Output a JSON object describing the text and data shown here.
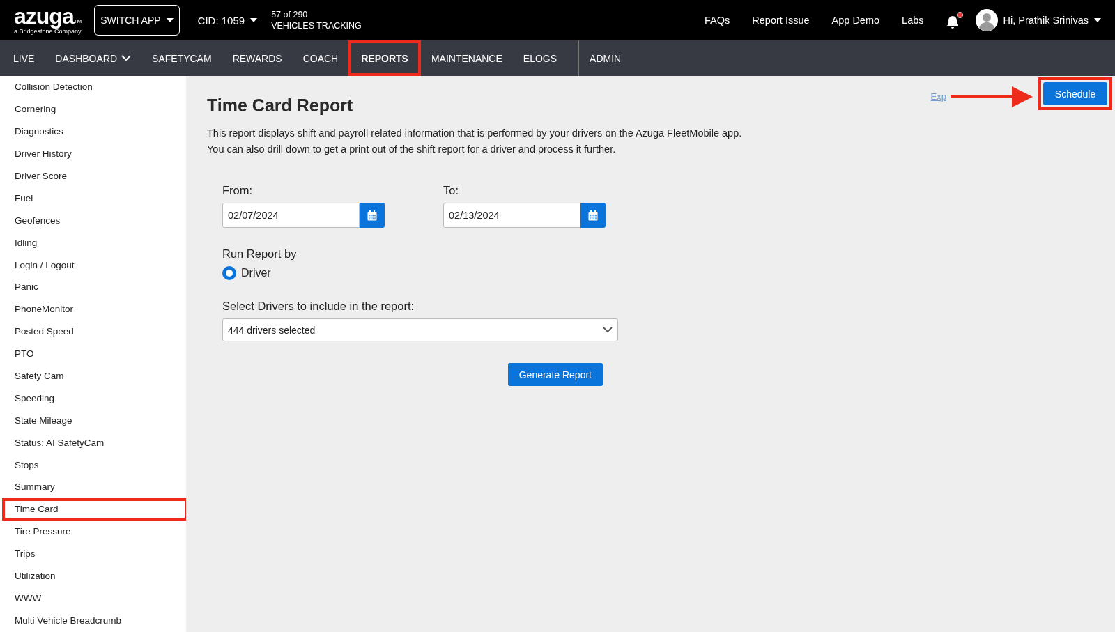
{
  "header": {
    "logo": "azuga",
    "logo_mark": "TM",
    "tagline": "a Bridgestone Company",
    "switch_app": "SWITCH APP",
    "cid": "CID: 1059",
    "tracking": [
      "57 of 290",
      "VEHICLES TRACKING"
    ],
    "links": [
      "FAQs",
      "Report Issue",
      "App Demo",
      "Labs"
    ],
    "notification_alert": true,
    "user": "Hi, Prathik Srinivas"
  },
  "nav": [
    {
      "label": "LIVE",
      "selected": false,
      "highlighted": false
    },
    {
      "label": "DASHBOARD",
      "selected": false,
      "highlighted": false,
      "dropdown": true
    },
    {
      "label": "SAFETYCAM",
      "selected": false,
      "highlighted": false
    },
    {
      "label": "REWARDS",
      "selected": false,
      "highlighted": false
    },
    {
      "label": "COACH",
      "selected": false,
      "highlighted": false
    },
    {
      "label": "REPORTS",
      "selected": true,
      "highlighted": true
    },
    {
      "label": "MAINTENANCE",
      "selected": false,
      "highlighted": false
    },
    {
      "label": "ELOGS",
      "selected": false,
      "highlighted": false
    },
    {
      "label": "ADMIN",
      "selected": false,
      "highlighted": false,
      "divider_before": true
    }
  ],
  "sidebar": {
    "items": [
      {
        "label": "Collision Detection",
        "highlighted": false
      },
      {
        "label": "Cornering",
        "highlighted": false
      },
      {
        "label": "Diagnostics",
        "highlighted": false
      },
      {
        "label": "Driver History",
        "highlighted": false
      },
      {
        "label": "Driver Score",
        "highlighted": false
      },
      {
        "label": "Fuel",
        "highlighted": false
      },
      {
        "label": "Geofences",
        "highlighted": false
      },
      {
        "label": "Idling",
        "highlighted": false
      },
      {
        "label": "Login / Logout",
        "highlighted": false
      },
      {
        "label": "Panic",
        "highlighted": false
      },
      {
        "label": "PhoneMonitor",
        "highlighted": false
      },
      {
        "label": "Posted Speed",
        "highlighted": false
      },
      {
        "label": "PTO",
        "highlighted": false
      },
      {
        "label": "Safety Cam",
        "highlighted": false
      },
      {
        "label": "Speeding",
        "highlighted": false
      },
      {
        "label": "State Mileage",
        "highlighted": false
      },
      {
        "label": "Status: AI SafetyCam",
        "highlighted": false
      },
      {
        "label": "Stops",
        "highlighted": false
      },
      {
        "label": "Summary",
        "highlighted": false
      },
      {
        "label": "Time Card",
        "highlighted": true
      },
      {
        "label": "Tire Pressure",
        "highlighted": false
      },
      {
        "label": "Trips",
        "highlighted": false
      },
      {
        "label": "Utilization",
        "highlighted": false
      },
      {
        "label": "WWW",
        "highlighted": false
      },
      {
        "label": "Multi Vehicle Breadcrumb",
        "highlighted": false
      }
    ]
  },
  "toolbar": {
    "export_link": "Exp",
    "schedule": {
      "label": "Schedule",
      "highlighted": true,
      "arrow": true
    }
  },
  "report": {
    "title": "Time Card Report",
    "description": "This report displays shift and payroll related information that is performed by your drivers on the Azuga FleetMobile app. You can also drill down to get a print out of the shift report for a driver and process it further.",
    "from": {
      "label": "From:",
      "value": "02/07/2024"
    },
    "to": {
      "label": "To:",
      "value": "02/13/2024"
    },
    "run_by": {
      "label": "Run Report by",
      "options": [
        {
          "label": "Driver",
          "selected": true
        }
      ]
    },
    "drivers": {
      "label": "Select Drivers to include in the report:",
      "value": "444 drivers selected"
    },
    "generate": "Generate Report"
  }
}
